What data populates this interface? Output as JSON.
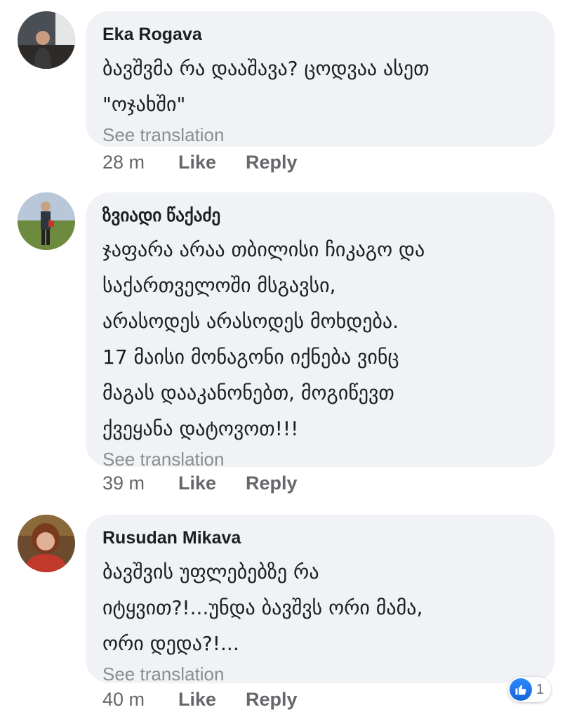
{
  "comments": [
    {
      "author": "Eka Rogava",
      "text": "ბავშვმა რა დააშავა? ცოდვაა ასეთ\n\"ოჯახში\"",
      "see_translation": "See translation",
      "time": "28 m",
      "like": "Like",
      "reply": "Reply"
    },
    {
      "author": "ზვიადი წაქაძე",
      "text": "ჯაფარა არაა თბილისი ჩიკაგო და\nსაქართველოში მსგავსი,\nარასოდეს არასოდეს მოხდება.\n 17 მაისი მონაგონი იქნება ვინც\nმაგას დააკანონებთ, მოგიწევთ\nქვეყანა დატოვოთ!!!",
      "see_translation": "See translation",
      "time": "39 m",
      "like": "Like",
      "reply": "Reply"
    },
    {
      "author": "Rusudan Mikava",
      "text": "ბავშვის უფლებებზე რა\nიტყვით?!...უნდა ბავშვს ორი მამა,\nორი დედა?!...",
      "see_translation": "See translation",
      "time": "40 m",
      "like": "Like",
      "reply": "Reply",
      "reaction": {
        "icon": "thumbs-up-icon",
        "count": "1",
        "color": "#1877f2"
      }
    }
  ]
}
